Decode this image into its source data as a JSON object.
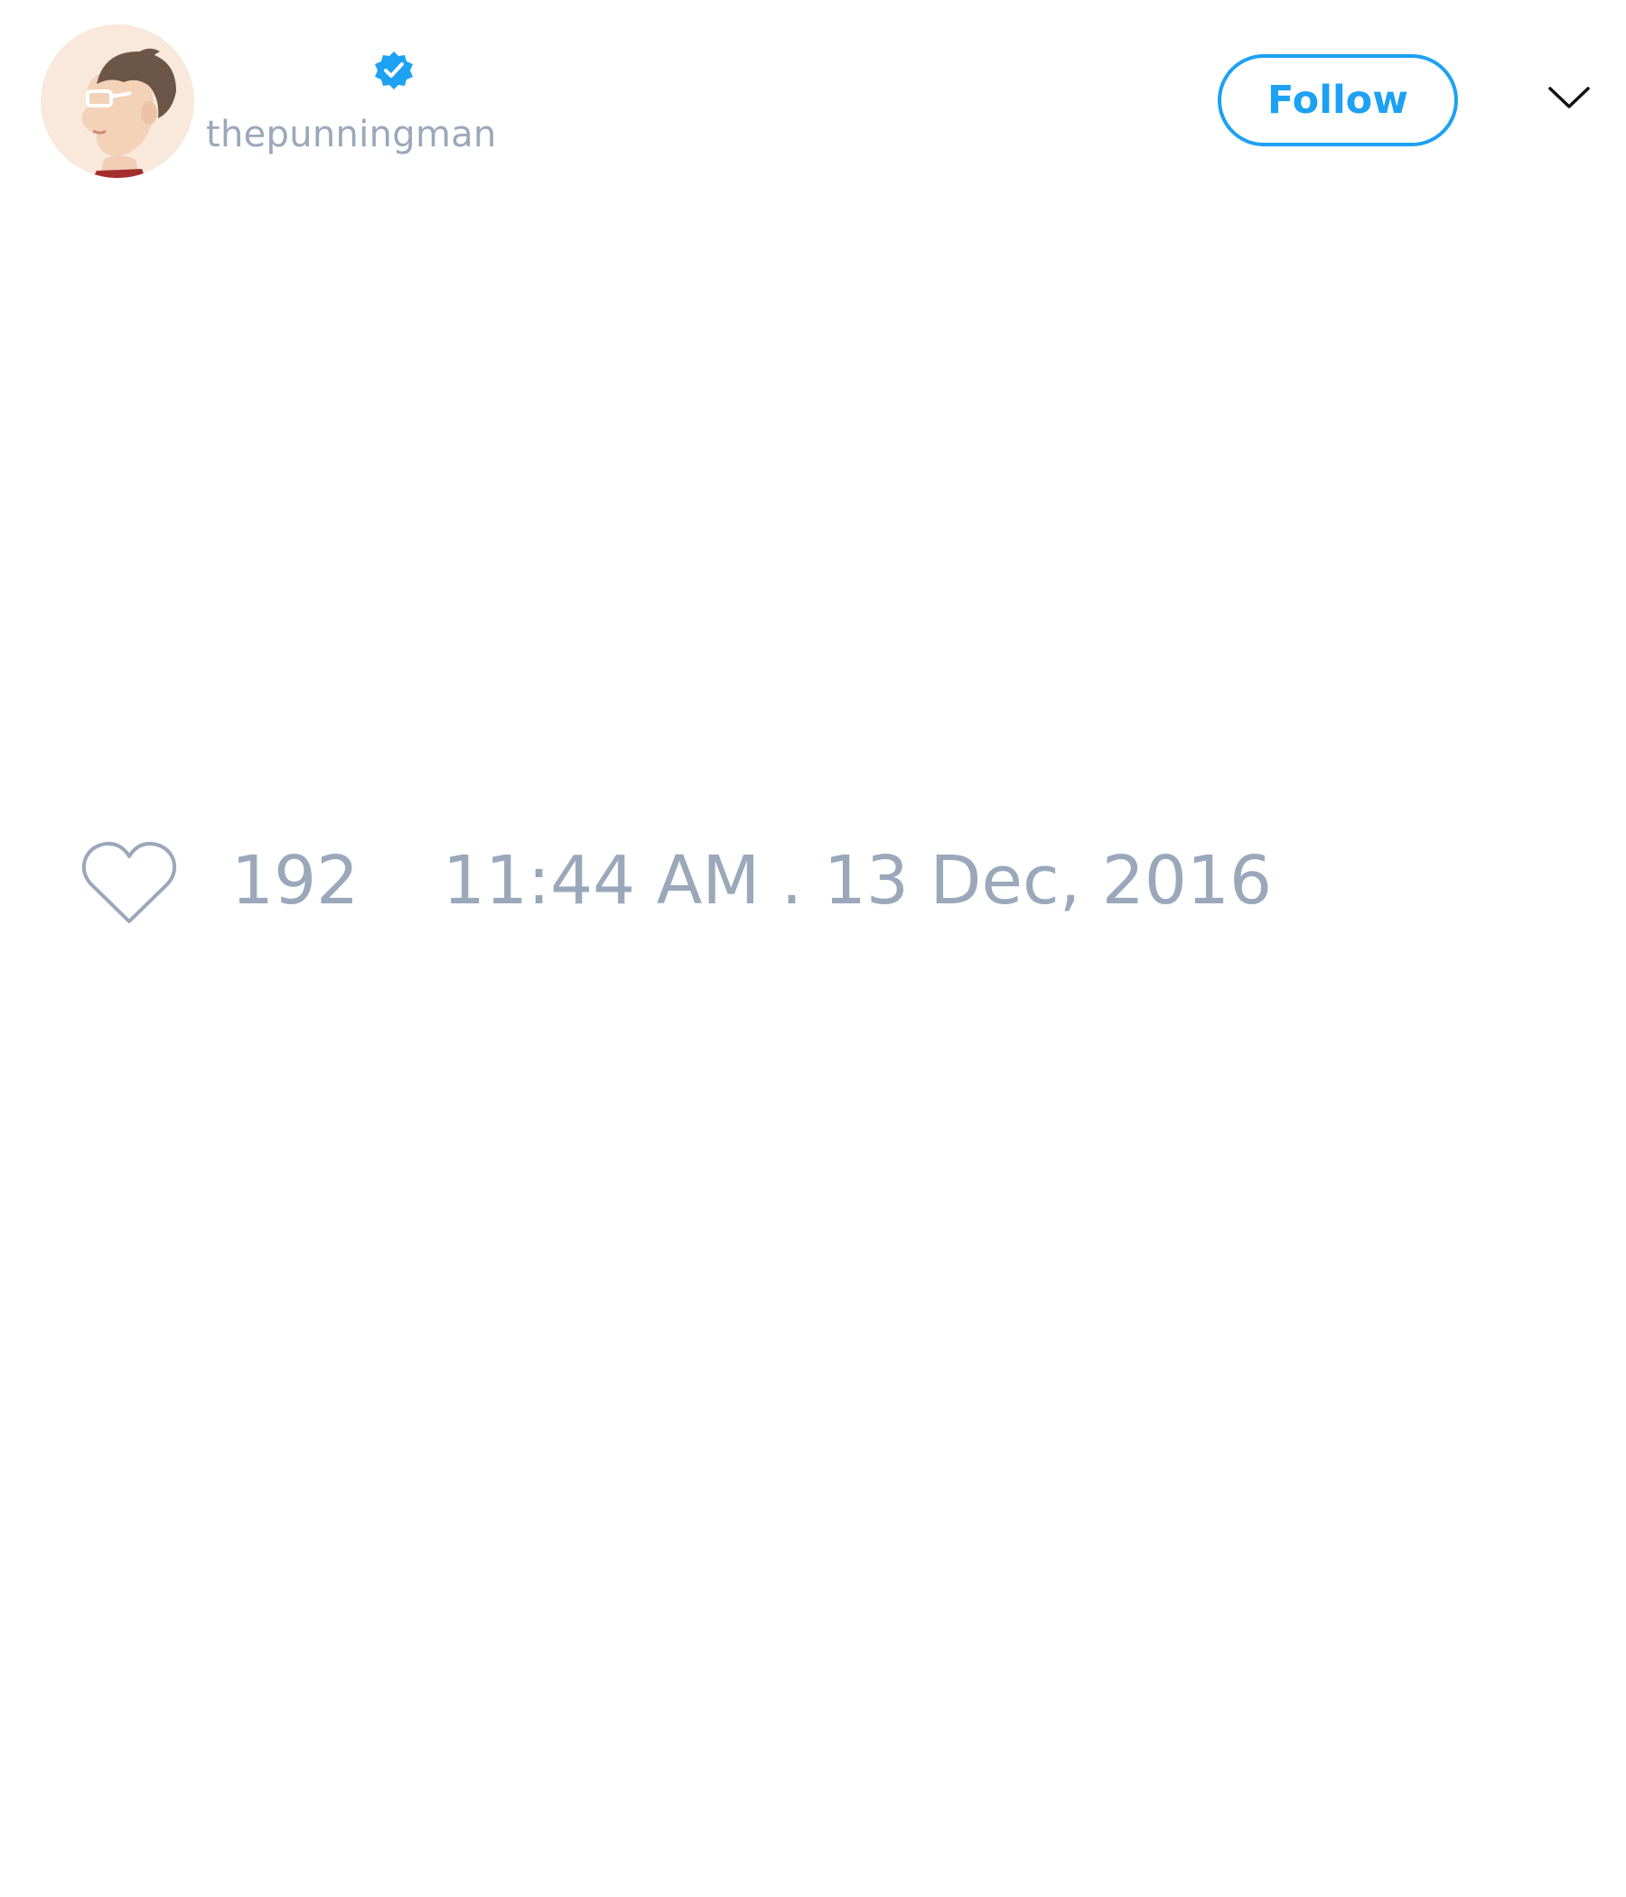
{
  "tweet": {
    "author": {
      "handle": "thepunningman",
      "verified": true,
      "avatar_icon": "cartoon-avatar"
    },
    "follow_label": "Follow",
    "menu_icon": "chevron-down-icon",
    "like_icon": "heart-outline-icon",
    "like_count": "192",
    "timestamp": "11:44 AM . 13 Dec, 2016"
  },
  "colors": {
    "accent": "#1da1f2",
    "muted_text": "#9aa8ba",
    "background": "#ffffff"
  }
}
